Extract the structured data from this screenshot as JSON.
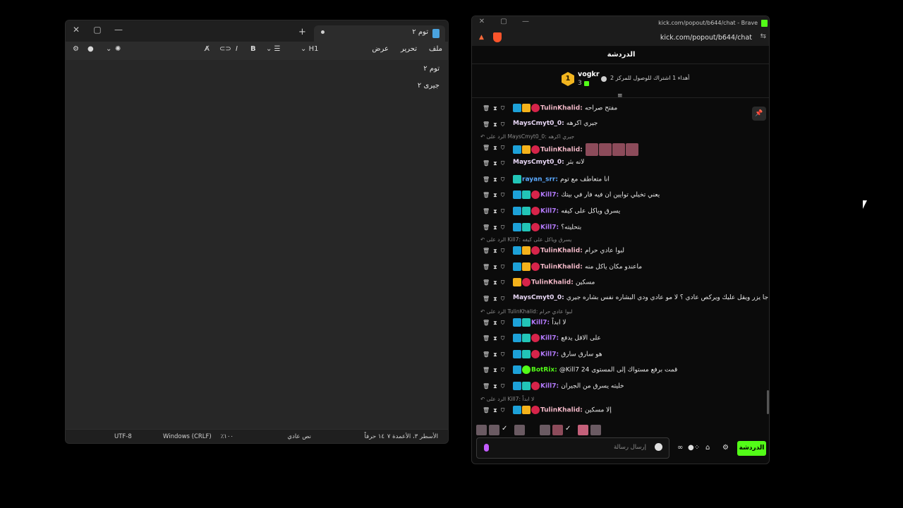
{
  "notepad": {
    "tab_title": "توم ٢",
    "menu": [
      "ملف",
      "تحرير",
      "عرض"
    ],
    "heading_label": "H1",
    "lines": [
      "توم ٢",
      "جيرى ٢"
    ],
    "status": {
      "position": "الأسطر ٣، الأعمدة ٧",
      "chars": "١٤ حرفاً",
      "format": "نص عادي",
      "zoom": "١٠٠٪",
      "line_ending": "Windows (CRLF)",
      "encoding": "UTF-8"
    }
  },
  "brave": {
    "title": "kick.com/popout/b644/chat - Brave",
    "url": "kick.com/popout/b644/chat"
  },
  "chat": {
    "header": "الدردشة",
    "pinned_gift": {
      "rank": "1",
      "user": "vogkr",
      "count": "3",
      "goal_text": "أهداء 1 اشتراك للوصول للمركز 2"
    },
    "messages": [
      {
        "type": "msg",
        "user": "TulinKhalid",
        "color": "gold",
        "badges": [
          "mod",
          "vip",
          "sub"
        ],
        "text": "مفتح صراحه"
      },
      {
        "type": "msg",
        "user": "MaysCmyt0_0",
        "color": "white",
        "badges": [],
        "text": "جيري اكرهه"
      },
      {
        "type": "reply",
        "text": "الرد على MaysCmyt0_0: جيري اكرهه"
      },
      {
        "type": "msg",
        "user": "TulinKhalid",
        "color": "gold",
        "badges": [
          "mod",
          "vip",
          "sub"
        ],
        "text": "",
        "emotes": 4
      },
      {
        "type": "msg",
        "user": "MaysCmyt0_0",
        "color": "white",
        "badges": [],
        "text": "لانه بثر"
      },
      {
        "type": "msg",
        "user": "rayan_srr",
        "color": "blue",
        "badges": [
          "og"
        ],
        "text": "انا متعاطف مع توم"
      },
      {
        "type": "msg",
        "user": "Kill7",
        "color": "purple",
        "badges": [
          "mod",
          "og",
          "sub"
        ],
        "text": "يعني تخيلي توايين ان فيه فار في بيتك"
      },
      {
        "type": "msg",
        "user": "Kill7",
        "color": "purple",
        "badges": [
          "mod",
          "og",
          "sub"
        ],
        "text": "يسرق وياكل على كيفه"
      },
      {
        "type": "msg",
        "user": "Kill7",
        "color": "purple",
        "badges": [
          "mod",
          "og",
          "sub"
        ],
        "text": "بتحليته؟"
      },
      {
        "type": "reply",
        "text": "الرد على Kill7: يسرق وياكل على كيفه"
      },
      {
        "type": "msg",
        "user": "TulinKhalid",
        "color": "gold",
        "badges": [
          "mod",
          "vip",
          "sub"
        ],
        "text": "لبوا عادي حرام"
      },
      {
        "type": "msg",
        "user": "TulinKhalid",
        "color": "gold",
        "badges": [
          "mod",
          "vip",
          "sub"
        ],
        "text": "ماعندو مكان ياكل منه"
      },
      {
        "type": "msg",
        "user": "TulinKhalid",
        "color": "gold",
        "badges": [
          "vip",
          "sub"
        ],
        "text": "مسكين"
      },
      {
        "type": "msg",
        "user": "MaysCmyt0_0",
        "color": "white",
        "badges": [],
        "text": "الحين انا جا يزر ويقل عليك ويركص عادي ؟ لا مو عادي ودي البشاره نفس بشاره جيري"
      },
      {
        "type": "reply",
        "text": "الرد على TulinKhalid: لبوا عادي حرام"
      },
      {
        "type": "msg",
        "user": "Kill7",
        "color": "purple",
        "badges": [
          "mod",
          "og"
        ],
        "text": "لا ابداً"
      },
      {
        "type": "msg",
        "user": "Kill7",
        "color": "purple",
        "badges": [
          "mod",
          "og",
          "sub"
        ],
        "text": "على الاقل يدفع"
      },
      {
        "type": "msg",
        "user": "Kill7",
        "color": "purple",
        "badges": [
          "mod",
          "og",
          "sub"
        ],
        "text": "هو سارق سارق"
      },
      {
        "type": "msg",
        "user": "BotRix",
        "color": "green",
        "badges": [
          "mod",
          "bot"
        ],
        "text": "@Kill7 قمت برفع مستواك إلى المستوى 24"
      },
      {
        "type": "msg",
        "user": "Kill7",
        "color": "purple",
        "badges": [
          "mod",
          "og",
          "sub"
        ],
        "text": "خليته يسرق من الجيران"
      },
      {
        "type": "reply",
        "text": "الرد على Kill7: لا ابداً"
      },
      {
        "type": "msg",
        "user": "TulinKhalid",
        "color": "gold",
        "badges": [
          "mod",
          "vip",
          "sub"
        ],
        "text": "إلا مسكين"
      }
    ],
    "composer_placeholder": "إرسال رسالة",
    "send_label": "الدردشة"
  }
}
